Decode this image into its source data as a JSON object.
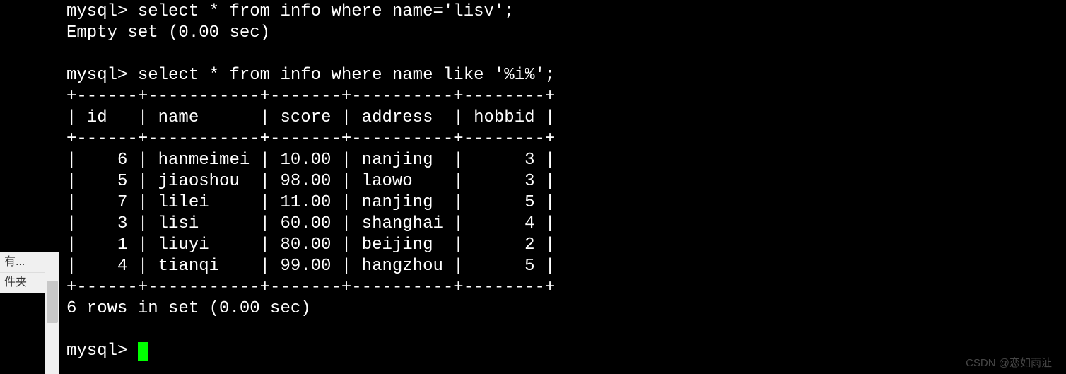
{
  "sidebar": {
    "item1": "有...",
    "item2": "件夹"
  },
  "terminal": {
    "top_line": "mysql> select * from info where name='lisv';",
    "empty_set": "Empty set (0.00 sec)",
    "blank": "",
    "query": "mysql> select * from info where name like '%i%';",
    "border_top": "+------+-----------+-------+----------+--------+",
    "header": "| id   | name      | score | address  | hobbid |",
    "border_mid": "+------+-----------+-------+----------+--------+",
    "rows": [
      "|    6 | hanmeimei | 10.00 | nanjing  |      3 |",
      "|    5 | jiaoshou  | 98.00 | laowo    |      3 |",
      "|    7 | lilei     | 11.00 | nanjing  |      5 |",
      "|    3 | lisi      | 60.00 | shanghai |      4 |",
      "|    1 | liuyi     | 80.00 | beijing  |      2 |",
      "|    4 | tianqi    | 99.00 | hangzhou |      5 |"
    ],
    "border_bot": "+------+-----------+-------+----------+--------+",
    "summary": "6 rows in set (0.00 sec)",
    "prompt": "mysql> "
  },
  "table_data": {
    "columns": [
      "id",
      "name",
      "score",
      "address",
      "hobbid"
    ],
    "rows": [
      {
        "id": 6,
        "name": "hanmeimei",
        "score": "10.00",
        "address": "nanjing",
        "hobbid": 3
      },
      {
        "id": 5,
        "name": "jiaoshou",
        "score": "98.00",
        "address": "laowo",
        "hobbid": 3
      },
      {
        "id": 7,
        "name": "lilei",
        "score": "11.00",
        "address": "nanjing",
        "hobbid": 5
      },
      {
        "id": 3,
        "name": "lisi",
        "score": "60.00",
        "address": "shanghai",
        "hobbid": 4
      },
      {
        "id": 1,
        "name": "liuyi",
        "score": "80.00",
        "address": "beijing",
        "hobbid": 2
      },
      {
        "id": 4,
        "name": "tianqi",
        "score": "99.00",
        "address": "hangzhou",
        "hobbid": 5
      }
    ]
  },
  "watermark": "CSDN @恋如雨沚"
}
